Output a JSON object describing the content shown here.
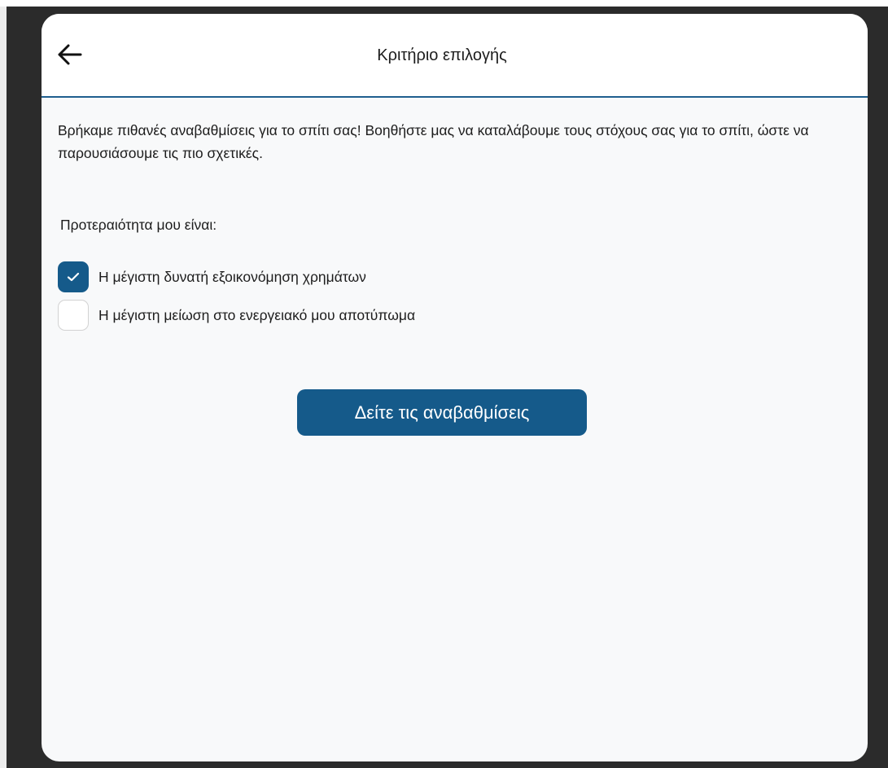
{
  "header": {
    "title": "Κριτήριο επιλογής",
    "back_icon": "arrow-left-icon"
  },
  "intro_text": "Βρήκαμε πιθανές αναβαθμίσεις για το σπίτι σας! Βοηθήστε μας να καταλάβουμε τους στόχους σας για το σπίτι, ώστε να παρουσιάσουμε τις πιο σχετικές.",
  "priority_label": "Προτεραιότητα μου είναι:",
  "options": [
    {
      "label": "Η μέγιστη δυνατή εξοικονόμηση χρημάτων",
      "checked": true
    },
    {
      "label": "Η μέγιστη μείωση στο ενεργειακό μου αποτύπωμα",
      "checked": false
    }
  ],
  "cta_label": "Δείτε τις αναβαθμίσεις",
  "colors": {
    "accent": "#155a8a",
    "header_divider": "#1f5f8f",
    "card_background": "#f8f9fa",
    "page_background": "#2b2b2b"
  }
}
